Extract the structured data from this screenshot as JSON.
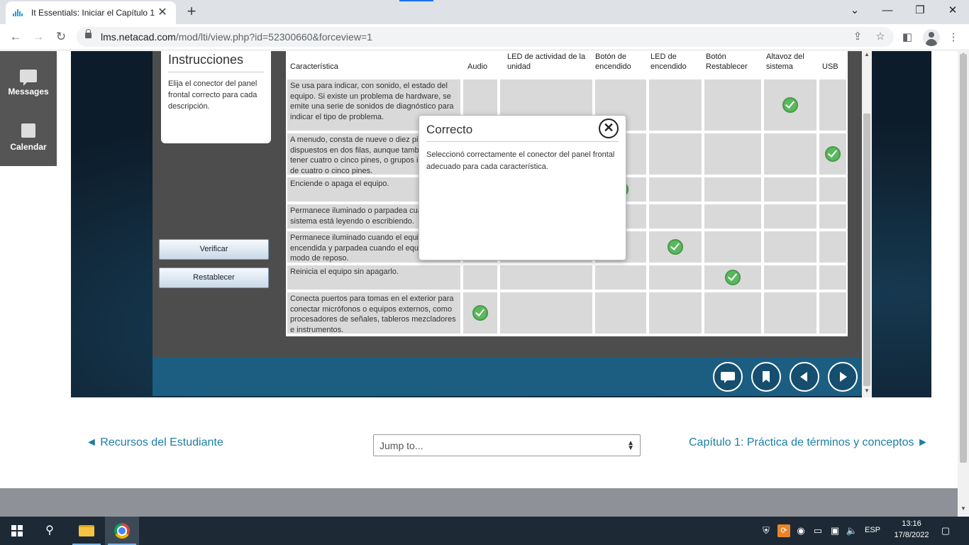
{
  "browser": {
    "tab_title": "It Essentials: Iniciar el Capítulo 1",
    "tab_close": "✕",
    "new_tab": "+",
    "url_host": "lms.netacad.com",
    "url_path": "/mod/lti/view.php?id=52300660&forceview=1",
    "window_controls": {
      "dropdown": "⌄",
      "minimize": "—",
      "restore": "❐",
      "close": "✕"
    }
  },
  "lms_sidebar": {
    "items": [
      {
        "label": "Messages",
        "icon": "messages-icon"
      },
      {
        "label": "Calendar",
        "icon": "calendar-icon"
      }
    ]
  },
  "activity": {
    "instructions_title": "Instrucciones",
    "instructions_text": "Elija el conector del panel frontal correcto para cada descripción.",
    "verify_label": "Verificar",
    "reset_label": "Restablecer",
    "headers": {
      "characteristic": "Característica",
      "audio": "Audio",
      "led_drive": "LED de actividad de la unidad",
      "power_button": "Botón de encendido",
      "power_led": "LED de encendido",
      "reset_button": "Botón Restablecer",
      "speaker": "Altavoz del sistema",
      "usb": "USB"
    },
    "rows": [
      "Se usa para indicar, con sonido, el estado del equipo. Si existe un problema de hardware, se emite una serie de sonidos de diagnóstico para indicar el tipo de problema.",
      "A menudo, consta de nueve o diez pines dispuestos en dos filas, aunque también puede tener cuatro o cinco pines, o grupos individuales de cuatro o cinco pines.",
      "Enciende o apaga el equipo.",
      "Permanece iluminado o parpadea cuando el sistema está leyendo o escribiendo.",
      "Permanece iluminado cuando el equipo está encendida y parpadea cuando el equipo está en modo de reposo.",
      "Reinicia el equipo sin apagarlo.",
      "Conecta puertos para tomas en el exterior para conectar micrófonos o equipos externos, como procesadores de señales, tableros mezcladores e instrumentos."
    ],
    "answers": [
      {
        "row": 0,
        "column": "speaker"
      },
      {
        "row": 1,
        "column": "usb"
      },
      {
        "row": 2,
        "column": "power_button"
      },
      {
        "row": 3,
        "column": "led_drive"
      },
      {
        "row": 4,
        "column": "power_led"
      },
      {
        "row": 5,
        "column": "reset_button"
      },
      {
        "row": 6,
        "column": "audio"
      }
    ]
  },
  "dialog": {
    "title": "Correcto",
    "close_symbol": "✕",
    "body": "Seleccionó correctamente el conector del panel frontal adecuado para cada característica."
  },
  "player_controls": [
    "comment-icon",
    "bookmark-icon",
    "previous-icon",
    "next-icon"
  ],
  "page_nav": {
    "prev_link": "◄ Recursos del Estudiante",
    "jump_placeholder": "Jump to...",
    "next_link": "Capítulo 1: Práctica de términos y conceptos ►"
  },
  "taskbar": {
    "language": "ESP",
    "time": "13:16",
    "date": "17/8/2022"
  },
  "colors": {
    "check_green": "#5bb85d",
    "player_bar": "#1b5e82",
    "link_blue": "#1b7fa5"
  }
}
